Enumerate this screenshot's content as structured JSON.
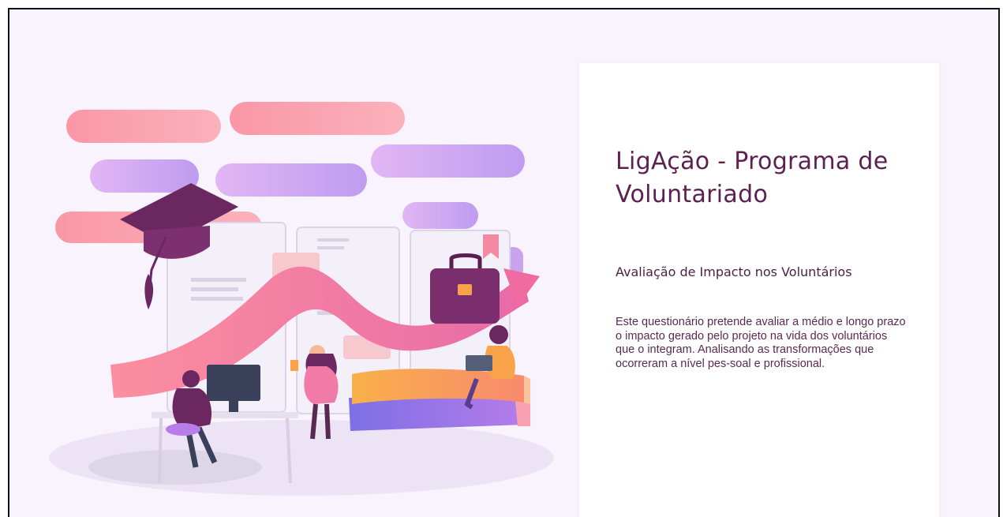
{
  "page": {
    "title": "LigAção - Programa de Voluntariado",
    "subtitle": "Avaliação de Impacto nos Voluntários",
    "description": "Este questionário pretende avaliar a médio e longo prazo o impacto gerado pelo projeto na vida dos voluntários que o integram. Analisando as transformações que ocorreram a nível pes-soal e profissional."
  },
  "illustration": {
    "icon": "education-volunteers-illustration",
    "colors": {
      "pink": "#f99aa8",
      "lavender": "#c9a3ee",
      "plum": "#6b2760",
      "orange": "#f8a34a",
      "blue": "#7a77ea"
    }
  }
}
